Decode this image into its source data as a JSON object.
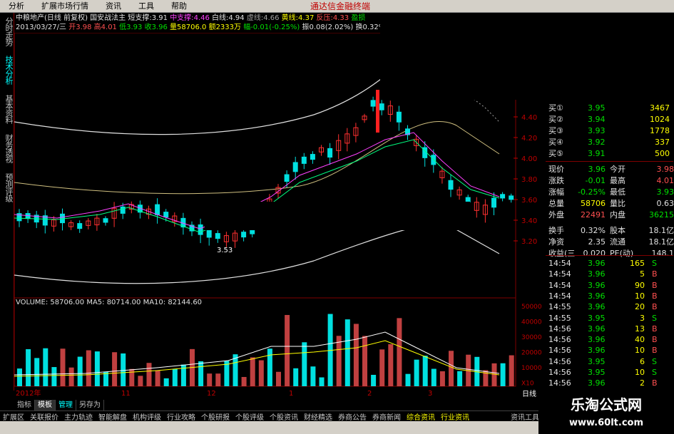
{
  "menu": {
    "items": [
      "分析",
      "扩展市场行情",
      "资讯",
      "工具",
      "帮助"
    ],
    "brand": "通达信金融终端"
  },
  "left_tabs": [
    {
      "label": "分时走势"
    },
    {
      "label": "技术分析",
      "active": true
    },
    {
      "label": "基本资料"
    },
    {
      "label": "财务透视"
    },
    {
      "label": "预测评级"
    }
  ],
  "header": {
    "line1": {
      "name": "中粮地产(日线 前复权)",
      "indicator": "国安战法主",
      "support_label": "短支撑:",
      "support": "3.91",
      "mid_label": "中支撑:",
      "mid": "4.46",
      "white_label": "白线:",
      "white": "4.94",
      "virtual_label": "虚线:",
      "virtual": "4.66",
      "yellow_label": "黄线:",
      "yellow": "4.37",
      "press_label": "反压:",
      "press": "4.33",
      "extra": "盈损"
    },
    "line2": {
      "date": "2013/03/27/三",
      "open_label": "开",
      "open": "3.98",
      "high_label": "高",
      "high": "4.01",
      "low_label": "低",
      "low": "3.93",
      "close_label": "收",
      "close": "3.96",
      "vol_label": "量",
      "vol": "58706.0",
      "amt_label": "额",
      "amt": "2333万",
      "chg_label": "幅",
      "chg": "-0.01(-0.25%)",
      "amp_label": "振",
      "amp": "0.08(2.02%)",
      "turn_label": "换",
      "turn": "0.32%",
      "flow_label": "流"
    }
  },
  "price_axis": {
    "labels": [
      "4.80",
      "4.60",
      "4.40",
      "4.20",
      "4.00",
      "3.80",
      "3.60",
      "3.40",
      "3.20"
    ]
  },
  "volume_axis": {
    "labels": [
      "50000",
      "40000",
      "30000",
      "20000",
      "10000",
      "X10"
    ]
  },
  "annotation": {
    "low_price": "3.53"
  },
  "volume_header": {
    "text": "VOLUME: 58706.00  MA5: 80714.00  MA10: 82144.60"
  },
  "x_axis": {
    "labels": [
      "2012年",
      "11",
      "12",
      "1",
      "2",
      "3"
    ],
    "right": "日线"
  },
  "quote": {
    "buys": [
      {
        "label": "买①",
        "price": "3.95",
        "vol": "3467"
      },
      {
        "label": "买②",
        "price": "3.94",
        "vol": "1024"
      },
      {
        "label": "买③",
        "price": "3.93",
        "vol": "1778"
      },
      {
        "label": "买④",
        "price": "3.92",
        "vol": "337"
      },
      {
        "label": "买⑤",
        "price": "3.91",
        "vol": "500"
      }
    ],
    "stats": [
      {
        "l1": "现价",
        "v1": "3.96",
        "l2": "今开",
        "v2": "3.98"
      },
      {
        "l1": "涨跌",
        "v1": "-0.01",
        "l2": "最高",
        "v2": "4.01"
      },
      {
        "l1": "涨幅",
        "v1": "-0.25%",
        "l2": "最低",
        "v2": "3.93"
      },
      {
        "l1": "总量",
        "v1": "58706",
        "l2": "量比",
        "v2": "0.63"
      },
      {
        "l1": "外盘",
        "v1": "22491",
        "l2": "内盘",
        "v2": "36215"
      },
      {
        "l1": "换手",
        "v1": "0.32%",
        "l2": "股本",
        "v2": "18.1亿"
      },
      {
        "l1": "净资",
        "v1": "2.35",
        "l2": "流通",
        "v2": "18.1亿"
      },
      {
        "l1": "收益(三",
        "v1": "0.020",
        "l2": "PE(动)",
        "v2": "148.1"
      }
    ],
    "ticks": [
      {
        "t": "14:54",
        "p": "3.96",
        "v": "165",
        "s": "S"
      },
      {
        "t": "14:54",
        "p": "3.96",
        "v": "5",
        "s": "B"
      },
      {
        "t": "14:54",
        "p": "3.96",
        "v": "90",
        "s": "B"
      },
      {
        "t": "14:54",
        "p": "3.96",
        "v": "10",
        "s": "B"
      },
      {
        "t": "14:55",
        "p": "3.96",
        "v": "20",
        "s": "B"
      },
      {
        "t": "14:55",
        "p": "3.95",
        "v": "3",
        "s": "S"
      },
      {
        "t": "14:56",
        "p": "3.96",
        "v": "13",
        "s": "B"
      },
      {
        "t": "14:56",
        "p": "3.96",
        "v": "40",
        "s": "B"
      },
      {
        "t": "14:56",
        "p": "3.96",
        "v": "10",
        "s": "B"
      },
      {
        "t": "14:56",
        "p": "3.95",
        "v": "6",
        "s": "S"
      },
      {
        "t": "14:56",
        "p": "3.95",
        "v": "10",
        "s": "S"
      },
      {
        "t": "14:56",
        "p": "3.96",
        "v": "2",
        "s": "B"
      }
    ]
  },
  "tabs2": [
    {
      "label": "指标"
    },
    {
      "label": "模板",
      "active": true
    },
    {
      "label": "管理",
      "blue": true
    },
    {
      "label": "另存为"
    }
  ],
  "bottom": {
    "items": [
      "扩展区",
      "关联报价",
      "主力轨迹",
      "智能解盘",
      "机构评级",
      "行业攻略",
      "个股研报",
      "个股评级",
      "个股资讯",
      "财经精选",
      "券商公告",
      "券商新闻",
      "综合资讯",
      "行业资讯"
    ],
    "right": "资讯工具"
  },
  "logo": {
    "name": "乐淘公式网",
    "url": "www.60lt.com"
  },
  "colors": {
    "up": "#ff3030",
    "down": "#00e0e0",
    "bg": "#000000"
  }
}
